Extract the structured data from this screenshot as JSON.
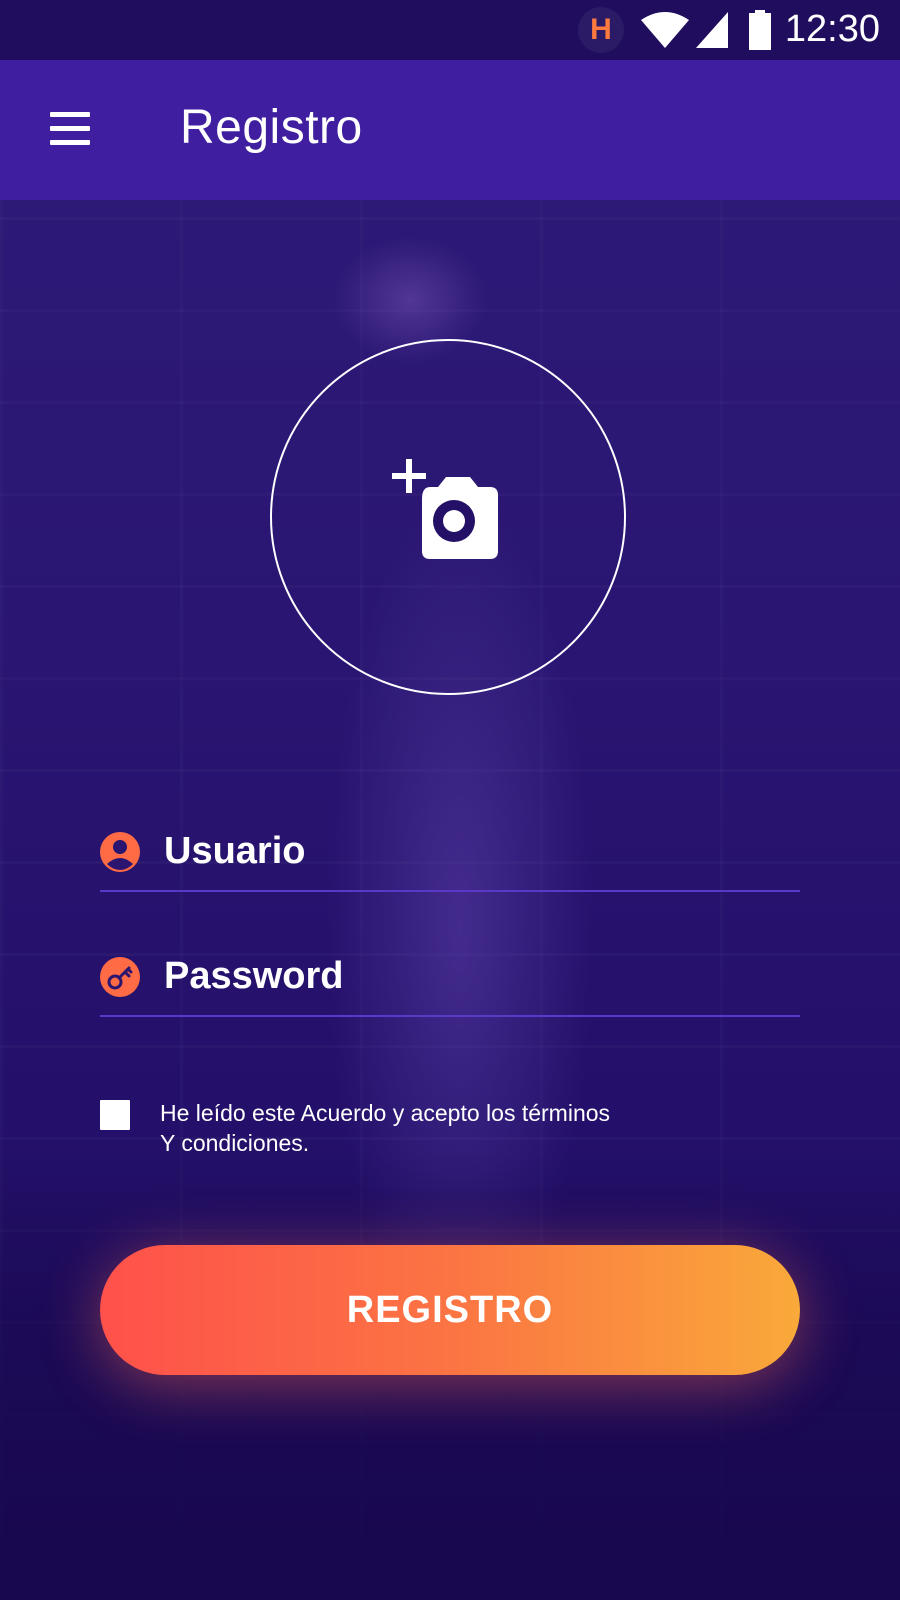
{
  "status_bar": {
    "app_icon": "dumbbell-app-icon",
    "app_icon_glyph": "H",
    "wifi_icon": "wifi-icon",
    "signal_icon": "signal-icon",
    "battery_icon": "battery-icon",
    "time": "12:30"
  },
  "app_bar": {
    "menu_icon": "hamburger-menu-icon",
    "title": "Registro",
    "background_color": "#3f1fa0"
  },
  "avatar": {
    "icon": "add-photo-icon"
  },
  "form": {
    "username": {
      "icon": "user-icon",
      "placeholder": "Usuario",
      "value": ""
    },
    "password": {
      "icon": "key-icon",
      "placeholder": "Password",
      "value": ""
    },
    "terms": {
      "checked": false,
      "line1": "He leído este Acuerdo y acepto los términos",
      "line2": "Y condiciones."
    },
    "submit_label": "REGISTRO"
  },
  "colors": {
    "accent": "#ff6b45",
    "accent_gradient_start": "#fe514b",
    "accent_gradient_end": "#f9a93a",
    "primary": "#3f1fa0",
    "status_bar": "#200d5e"
  }
}
